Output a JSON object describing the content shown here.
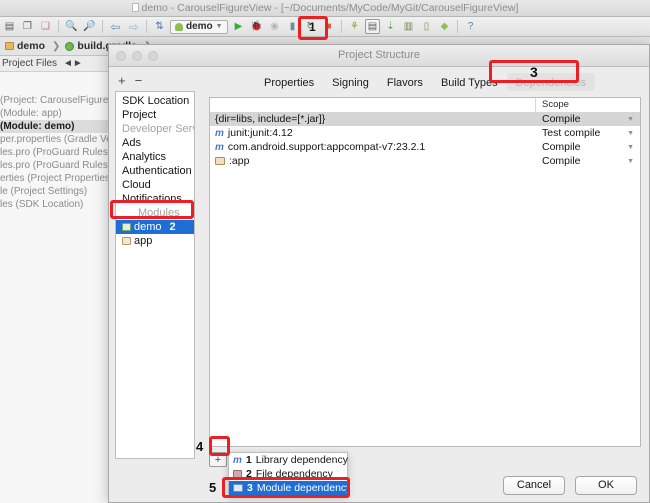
{
  "ide": {
    "window_title": "demo - CarouselFigureView - [~/Documents/MyCode/MyGit/CarouselFigureView]",
    "run_config": "demo",
    "toolbar_icons": [
      "open-icon",
      "copy-icon",
      "paste-icon",
      "find-icon",
      "find-replace-icon",
      "back-icon",
      "forward-icon",
      "sync-icon"
    ],
    "toolbar_icons_right": [
      "run-icon",
      "debug-icon",
      "coverage-icon",
      "attach-debugger-icon",
      "rerun-icon",
      "stop-icon",
      "avd-icon",
      "sdk-manager-icon",
      "device-monitor-icon",
      "layout-inspector-icon",
      "sync-gradle-icon",
      "android-icon",
      "help-icon"
    ],
    "breadcrumbs": [
      {
        "label": "demo",
        "icon": "folder-icon"
      },
      {
        "label": "build.gradle",
        "icon": "gradle-icon"
      }
    ],
    "panel_label": "Project Files",
    "tree": [
      {
        "text": "(Project: CarouselFigureVie",
        "selected": false
      },
      {
        "text": "(Module: app)",
        "selected": false
      },
      {
        "text": "(Module: demo)",
        "selected": true
      },
      {
        "text": "per.properties (Gradle Ver",
        "selected": false
      },
      {
        "text": "les.pro (ProGuard Rules for",
        "selected": false
      },
      {
        "text": "les.pro (ProGuard Rules for",
        "selected": false
      },
      {
        "text": "erties (Project Properties)",
        "selected": false
      },
      {
        "text": "le (Project Settings)",
        "selected": false
      },
      {
        "text": "les (SDK Location)",
        "selected": false
      }
    ]
  },
  "dialog": {
    "title": "Project Structure",
    "left_tools": {
      "add": "+",
      "remove": "−"
    },
    "nav_items": [
      {
        "label": "SDK Location",
        "type": "item",
        "selected": false
      },
      {
        "label": "Project",
        "type": "item",
        "selected": false
      },
      {
        "label": "Developer Services",
        "type": "header",
        "selected": false
      },
      {
        "label": "Ads",
        "type": "item",
        "selected": false
      },
      {
        "label": "Analytics",
        "type": "item",
        "selected": false
      },
      {
        "label": "Authentication",
        "type": "item",
        "selected": false
      },
      {
        "label": "Cloud",
        "type": "item",
        "selected": false
      },
      {
        "label": "Notifications",
        "type": "item",
        "selected": false
      },
      {
        "label": "Modules",
        "type": "header",
        "selected": false
      },
      {
        "label": "demo",
        "type": "module",
        "selected": true,
        "badge": "2"
      },
      {
        "label": "app",
        "type": "module",
        "selected": false
      }
    ],
    "tabs": [
      {
        "label": "Properties",
        "active": false
      },
      {
        "label": "Signing",
        "active": false
      },
      {
        "label": "Flavors",
        "active": false
      },
      {
        "label": "Build Types",
        "active": false
      },
      {
        "label": "Dependencies",
        "active": true
      }
    ],
    "table": {
      "columns": [
        "",
        "Scope"
      ],
      "rows": [
        {
          "icon": "none",
          "name": "{dir=libs, include=[*.jar]}",
          "scope": "Compile",
          "selected": true
        },
        {
          "icon": "maven-icon",
          "name": "junit:junit:4.12",
          "scope": "Test compile",
          "selected": false
        },
        {
          "icon": "maven-icon",
          "name": "com.android.support:appcompat-v7:23.2.1",
          "scope": "Compile",
          "selected": false
        },
        {
          "icon": "module-icon",
          "name": ":app",
          "scope": "Compile",
          "selected": false
        }
      ]
    },
    "table_tools": [
      {
        "name": "add-dependency-button",
        "glyph": "+",
        "enabled": true
      },
      {
        "name": "remove-dependency-button",
        "glyph": "−",
        "enabled": true
      },
      {
        "name": "move-up-button",
        "glyph": "▲",
        "enabled": false
      },
      {
        "name": "move-down-button",
        "glyph": "▼",
        "enabled": false
      }
    ],
    "popup_menu": [
      {
        "num": "1",
        "label": "Library dependency",
        "icon": "maven-icon",
        "highlighted": false
      },
      {
        "num": "2",
        "label": "File dependency",
        "icon": "jar-icon",
        "highlighted": false
      },
      {
        "num": "3",
        "label": "Module dependency",
        "icon": "module-icon",
        "highlighted": true
      }
    ],
    "buttons": {
      "cancel": "Cancel",
      "ok": "OK"
    }
  },
  "annotations": {
    "color": "#ec2024",
    "markers": [
      {
        "id": "1",
        "target": "sdk-manager-toolbar-icon"
      },
      {
        "id": "2",
        "target": "module-demo"
      },
      {
        "id": "3",
        "target": "tab-dependencies"
      },
      {
        "id": "4",
        "target": "add-dependency-button"
      },
      {
        "id": "5",
        "target": "menu-module-dependency"
      }
    ],
    "labels": {
      "m1": "1",
      "m2": "2",
      "m3": "3",
      "m4": "4",
      "m5": "5"
    }
  }
}
